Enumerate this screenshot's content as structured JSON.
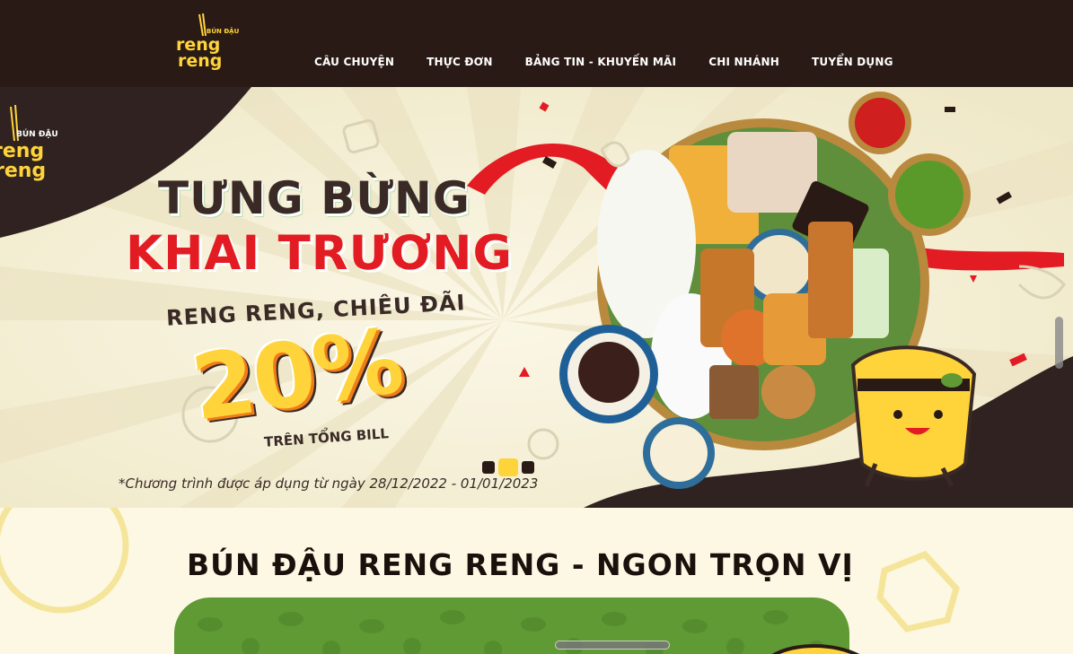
{
  "header": {
    "logo_alt": "Bún Đậu Reng Reng",
    "logo_top": "BÚN ĐẬU",
    "logo_l1": "reng",
    "logo_l2": "reng",
    "nav": [
      {
        "label": "CÂU CHUYỆN"
      },
      {
        "label": "THỰC ĐƠN"
      },
      {
        "label": "BẢNG TIN - KHUYẾN MÃI"
      },
      {
        "label": "CHI NHÁNH"
      },
      {
        "label": "TUYỂN DỤNG"
      }
    ]
  },
  "hero": {
    "title_line1": "TƯNG BỪNG",
    "title_line2": "KHAI TRƯƠNG",
    "subtitle": "RENG RENG, CHIÊU ĐÃI",
    "percent": "20%",
    "bill": "TRÊN TỔNG BILL",
    "note": "*Chương trình được áp dụng từ ngày 28/12/2022 - 01/01/2023",
    "slide_count": 3,
    "active_slide": 2
  },
  "section": {
    "title": "BÚN ĐẬU RENG RENG  -  NGON TRỌN VỊ"
  },
  "colors": {
    "header_bg": "#2a1a15",
    "accent_red": "#e31b23",
    "accent_yellow": "#ffd43a",
    "green": "#5f9a34",
    "cream": "#fdf8e4"
  }
}
